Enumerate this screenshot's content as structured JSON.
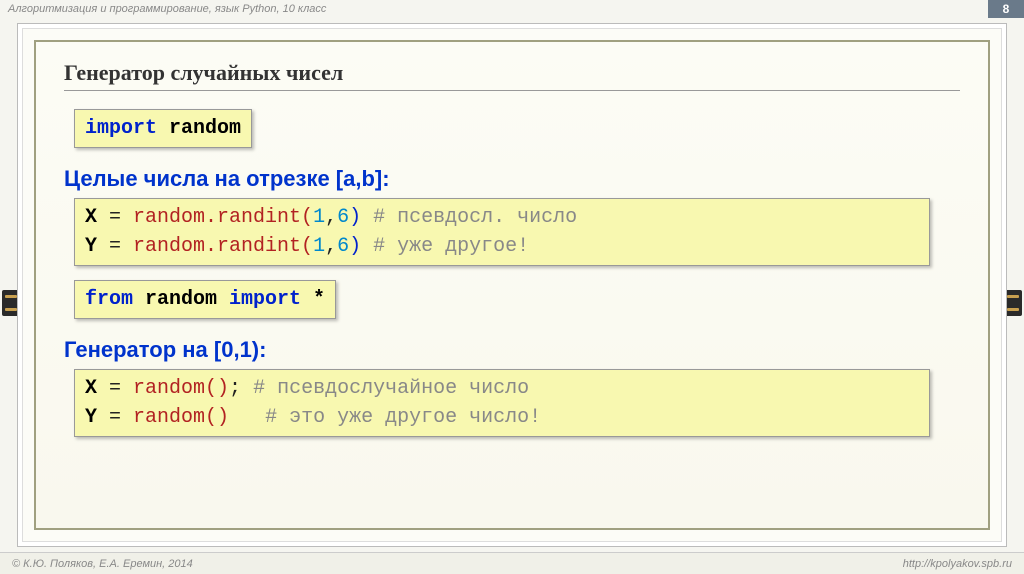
{
  "header": {
    "course": "Алгоритмизация и программирование, язык Python, 10 класс",
    "page": "8"
  },
  "title": "Генератор случайных чисел",
  "code1": {
    "t1": "import",
    "t2": " random"
  },
  "sub1": "Целые числа на отрезке [a,b]:",
  "code2": {
    "l1a": "X",
    "l1b": " = ",
    "l1c": "random.randint(",
    "l1d": "1",
    "l1e": ",",
    "l1f": "6",
    "l1g": ")",
    "l1h": " # псевдосл. число",
    "l2a": "Y",
    "l2b": " = ",
    "l2c": "random.randint(",
    "l2d": "1",
    "l2e": ",",
    "l2f": "6",
    "l2g": ")",
    "l2h": " # уже другое!"
  },
  "code3": {
    "t1": "from",
    "t2": " random ",
    "t3": "import",
    "t4": " *"
  },
  "sub2": "Генератор на [0,1):",
  "code4": {
    "l1a": "X",
    "l1b": " = ",
    "l1c": "random()",
    "l1d": "; ",
    "l1e": "# псевдослучайное число",
    "l2a": "Y",
    "l2b": " = ",
    "l2c": "random()",
    "l2d": "   ",
    "l2e": "# это уже другое число!"
  },
  "footer": {
    "left": "© К.Ю. Поляков, Е.А. Еремин, 2014",
    "right": "http://kpolyakov.spb.ru"
  }
}
